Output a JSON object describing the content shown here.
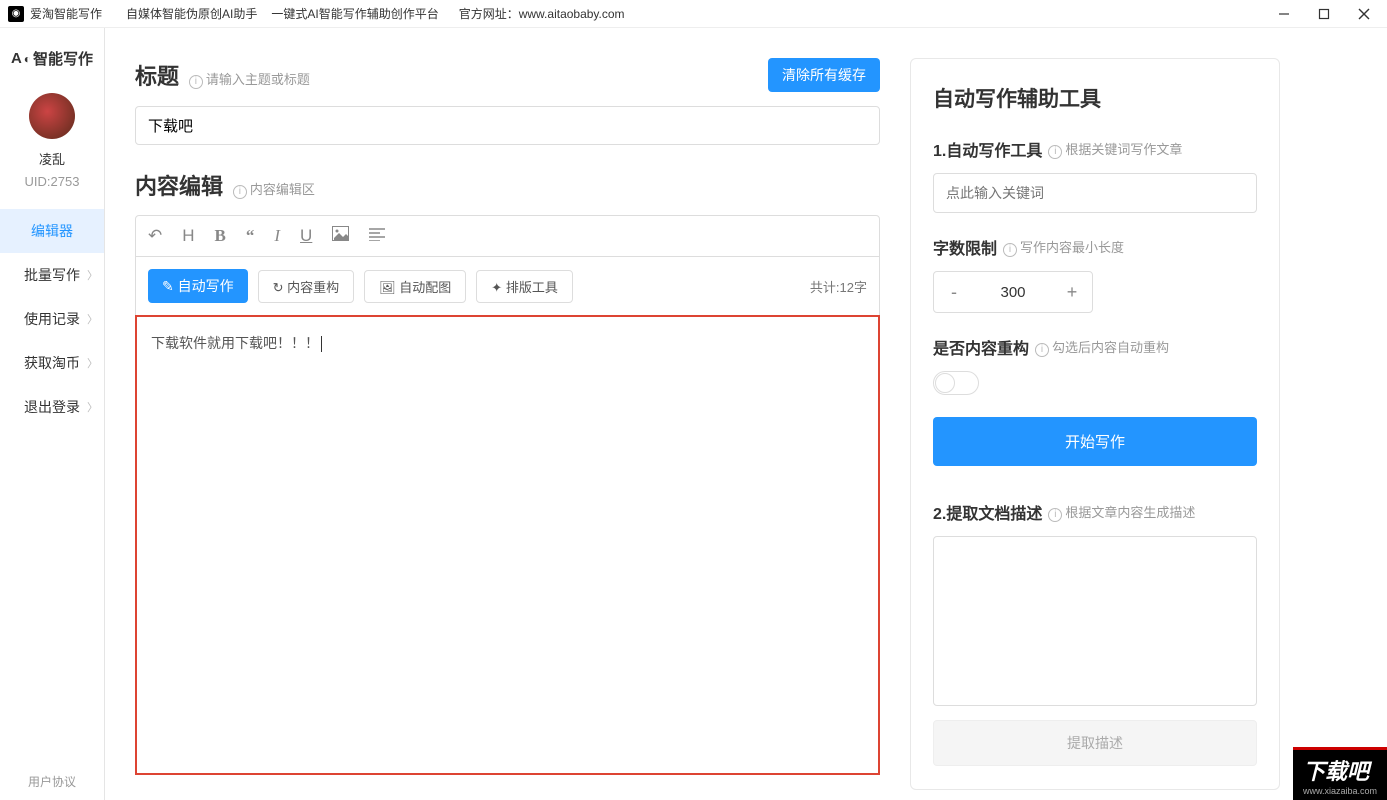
{
  "titlebar": {
    "app_name": "爱淘智能写作",
    "tagline1": "自媒体智能伪原创AI助手",
    "tagline2": "一键式AI智能写作辅助创作平台",
    "site_label": "官方网址：",
    "site_url": "www.aitaobaby.com"
  },
  "sidebar": {
    "logo": "智能写作",
    "username": "凌乱",
    "uid": "UID:2753",
    "items": [
      "编辑器",
      "批量写作",
      "使用记录",
      "获取淘币",
      "退出登录"
    ],
    "footer": "用户协议"
  },
  "editor": {
    "title_label": "标题",
    "title_hint": "请输入主题或标题",
    "clear_cache": "清除所有缓存",
    "title_value": "下载吧",
    "content_label": "内容编辑",
    "content_hint": "内容编辑区",
    "actions": {
      "auto_write": "自动写作",
      "rebuild": "内容重构",
      "auto_image": "自动配图",
      "layout_tool": "排版工具"
    },
    "counter": "共计:12字",
    "body_text": "下载软件就用下载吧！！！"
  },
  "tools": {
    "panel_title": "自动写作辅助工具",
    "section1_label": "1.自动写作工具",
    "section1_hint": "根据关键词写作文章",
    "keyword_placeholder": "点此输入关键词",
    "limit_label": "字数限制",
    "limit_hint": "写作内容最小长度",
    "limit_value": "300",
    "rebuild_label": "是否内容重构",
    "rebuild_hint": "勾选后内容自动重构",
    "start_btn": "开始写作",
    "section2_label": "2.提取文档描述",
    "section2_hint": "根据文章内容生成描述",
    "extract_btn": "提取描述"
  },
  "watermark": {
    "text": "下载吧",
    "url": "www.xiazaiba.com"
  }
}
